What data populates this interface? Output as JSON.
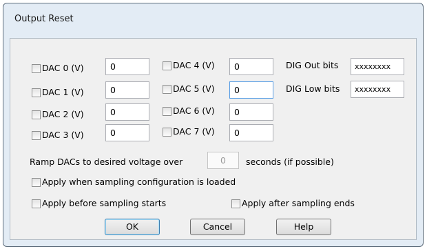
{
  "window": {
    "title": "Output Reset"
  },
  "dacs": [
    {
      "label": "DAC 0 (V)",
      "value": "0"
    },
    {
      "label": "DAC 1 (V)",
      "value": "0"
    },
    {
      "label": "DAC 2 (V)",
      "value": "0"
    },
    {
      "label": "DAC 3 (V)",
      "value": "0"
    },
    {
      "label": "DAC 4 (V)",
      "value": "0"
    },
    {
      "label": "DAC 5 (V)",
      "value": "0"
    },
    {
      "label": "DAC 6 (V)",
      "value": "0"
    },
    {
      "label": "DAC 7 (V)",
      "value": "0"
    }
  ],
  "dig": {
    "out_label": "DIG Out bits",
    "out_value": "xxxxxxxx",
    "low_label": "DIG Low bits",
    "low_value": "xxxxxxxx"
  },
  "ramp": {
    "prefix": "Ramp DACs to desired voltage over",
    "value": "0",
    "suffix": "seconds (if possible)"
  },
  "options": {
    "apply_loaded": "Apply when sampling configuration is loaded",
    "apply_before": "Apply before sampling starts",
    "apply_after": "Apply after sampling ends"
  },
  "buttons": {
    "ok": "OK",
    "cancel": "Cancel",
    "help": "Help"
  }
}
